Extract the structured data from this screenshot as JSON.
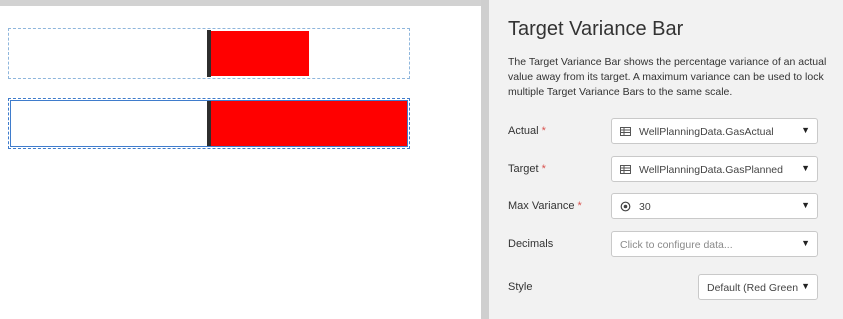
{
  "canvas": {
    "bars": [
      {
        "target_position_pct": 50,
        "actual_variance_pct": 25,
        "color": "#ff0000",
        "selected": false
      },
      {
        "target_position_pct": 50,
        "actual_variance_pct": 50,
        "color": "#ff0000",
        "selected": true
      }
    ]
  },
  "panel": {
    "title": "Target Variance Bar",
    "description": "The Target Variance Bar shows the percentage variance of an actual value away from its target. A maximum variance can be used to lock multiple Target Variance Bars to the same scale.",
    "fields": {
      "actual": {
        "label": "Actual",
        "required": "*",
        "value": "WellPlanningData.GasActual",
        "icon": "table-icon"
      },
      "target": {
        "label": "Target",
        "required": "*",
        "value": "WellPlanningData.GasPlanned",
        "icon": "table-icon"
      },
      "max_variance": {
        "label": "Max Variance",
        "required": "*",
        "value": "30",
        "icon": "radio-target-icon"
      },
      "decimals": {
        "label": "Decimals",
        "placeholder": "Click to configure data..."
      },
      "style": {
        "label": "Style",
        "value": "Default (Red Green"
      }
    },
    "dropdown_arrow": "▼"
  }
}
